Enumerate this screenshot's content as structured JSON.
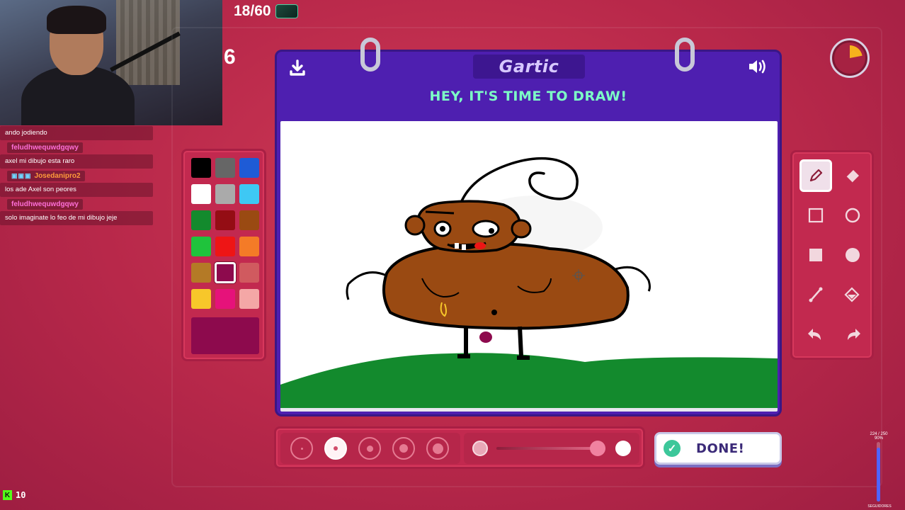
{
  "round": {
    "text": "18/60"
  },
  "side_number": "6",
  "chat": {
    "messages": [
      {
        "user": "",
        "text": "ando jodiendo",
        "user_color": "#ff6fd8"
      },
      {
        "user": "feludhwequwdgqwy",
        "text": "axel mi dibujo esta raro",
        "user_color": "#ff6fd8"
      },
      {
        "user": "Josedanipro2",
        "text": "los ade Axel son peores",
        "user_color": "#ff9b3b",
        "badges": true
      },
      {
        "user": "feludhwequwdgqwy",
        "text": "solo imaginate lo feo de mi dibujo jeje",
        "user_color": "#ff6fd8"
      }
    ]
  },
  "palette": {
    "swatches": [
      "#000000",
      "#666666",
      "#1e5bd6",
      "#ffffff",
      "#aaaaaa",
      "#3ec8f4",
      "#138a2d",
      "#940d14",
      "#9a4a12",
      "#1fc33c",
      "#ee1515",
      "#f47b27",
      "#b47a26",
      "#8d0a4d",
      "#d05a5f",
      "#f7c72a",
      "#e6127a",
      "#f4a7a6"
    ],
    "selected_index": 13,
    "current_color": "#8d0a4d"
  },
  "board": {
    "logo": "Gartic",
    "prompt": "HEY, IT'S TIME TO DRAW!",
    "colors": {
      "board": "#4e1fb0",
      "prompt": "#7dffc6"
    }
  },
  "timer": {
    "remaining_fraction": 0.78
  },
  "tools": [
    "pencil-icon",
    "eraser-icon",
    "rectangle-outline-icon",
    "circle-outline-icon",
    "rectangle-fill-icon",
    "circle-fill-icon",
    "line-icon",
    "fill-bucket-icon",
    "undo-icon",
    "redo-icon"
  ],
  "active_tool": "pencil-icon",
  "brush_sizes": {
    "count": 5,
    "selected_index": 1
  },
  "opacity": {
    "value": 0.95
  },
  "done_button": {
    "label": "DONE!"
  },
  "kick": {
    "viewers": "10"
  },
  "goal": {
    "count": "224 / 250",
    "sub": "90%",
    "label": "SEGUIDORES",
    "fraction": 0.9
  }
}
